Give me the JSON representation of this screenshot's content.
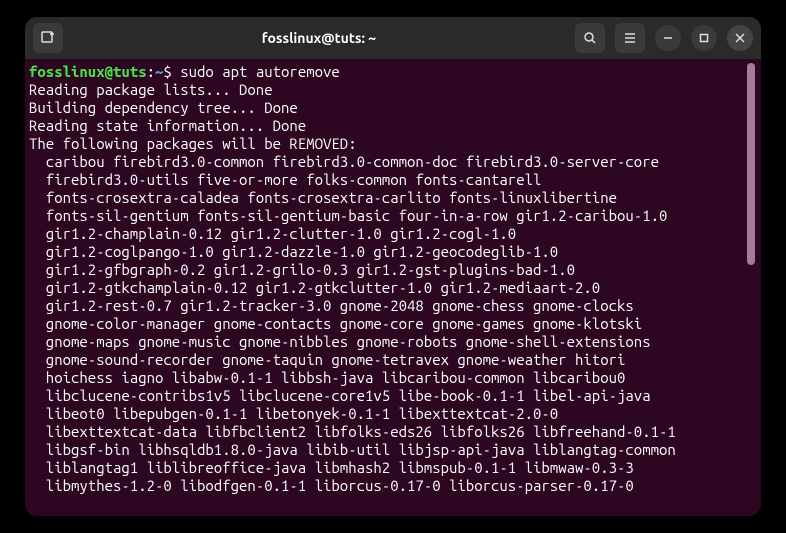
{
  "titlebar": {
    "title": "fosslinux@tuts: ~"
  },
  "prompt": {
    "user_host": "fosslinux@tuts",
    "colon": ":",
    "path": "~",
    "dollar": "$ "
  },
  "command": "sudo apt autoremove",
  "output": {
    "line1": "Reading package lists... Done",
    "line2": "Building dependency tree... Done",
    "line3": "Reading state information... Done",
    "line4": "The following packages will be REMOVED:",
    "pkg1": "  caribou firebird3.0-common firebird3.0-common-doc firebird3.0-server-core",
    "pkg2": "  firebird3.0-utils five-or-more folks-common fonts-cantarell",
    "pkg3": "  fonts-crosextra-caladea fonts-crosextra-carlito fonts-linuxlibertine",
    "pkg4": "  fonts-sil-gentium fonts-sil-gentium-basic four-in-a-row gir1.2-caribou-1.0",
    "pkg5": "  gir1.2-champlain-0.12 gir1.2-clutter-1.0 gir1.2-cogl-1.0",
    "pkg6": "  gir1.2-coglpango-1.0 gir1.2-dazzle-1.0 gir1.2-geocodeglib-1.0",
    "pkg7": "  gir1.2-gfbgraph-0.2 gir1.2-grilo-0.3 gir1.2-gst-plugins-bad-1.0",
    "pkg8": "  gir1.2-gtkchamplain-0.12 gir1.2-gtkclutter-1.0 gir1.2-mediaart-2.0",
    "pkg9": "  gir1.2-rest-0.7 gir1.2-tracker-3.0 gnome-2048 gnome-chess gnome-clocks",
    "pkg10": "  gnome-color-manager gnome-contacts gnome-core gnome-games gnome-klotski",
    "pkg11": "  gnome-maps gnome-music gnome-nibbles gnome-robots gnome-shell-extensions",
    "pkg12": "  gnome-sound-recorder gnome-taquin gnome-tetravex gnome-weather hitori",
    "pkg13": "  hoichess iagno libabw-0.1-1 libbsh-java libcaribou-common libcaribou0",
    "pkg14": "  libclucene-contribs1v5 libclucene-core1v5 libe-book-0.1-1 libel-api-java",
    "pkg15": "  libeot0 libepubgen-0.1-1 libetonyek-0.1-1 libexttextcat-2.0-0",
    "pkg16": "  libexttextcat-data libfbclient2 libfolks-eds26 libfolks26 libfreehand-0.1-1",
    "pkg17": "  libgsf-bin libhsqldb1.8.0-java libib-util libjsp-api-java liblangtag-common",
    "pkg18": "  liblangtag1 liblibreoffice-java libmhash2 libmspub-0.1-1 libmwaw-0.3-3",
    "pkg19": "  libmythes-1.2-0 libodfgen-0.1-1 liborcus-0.17-0 liborcus-parser-0.17-0"
  }
}
